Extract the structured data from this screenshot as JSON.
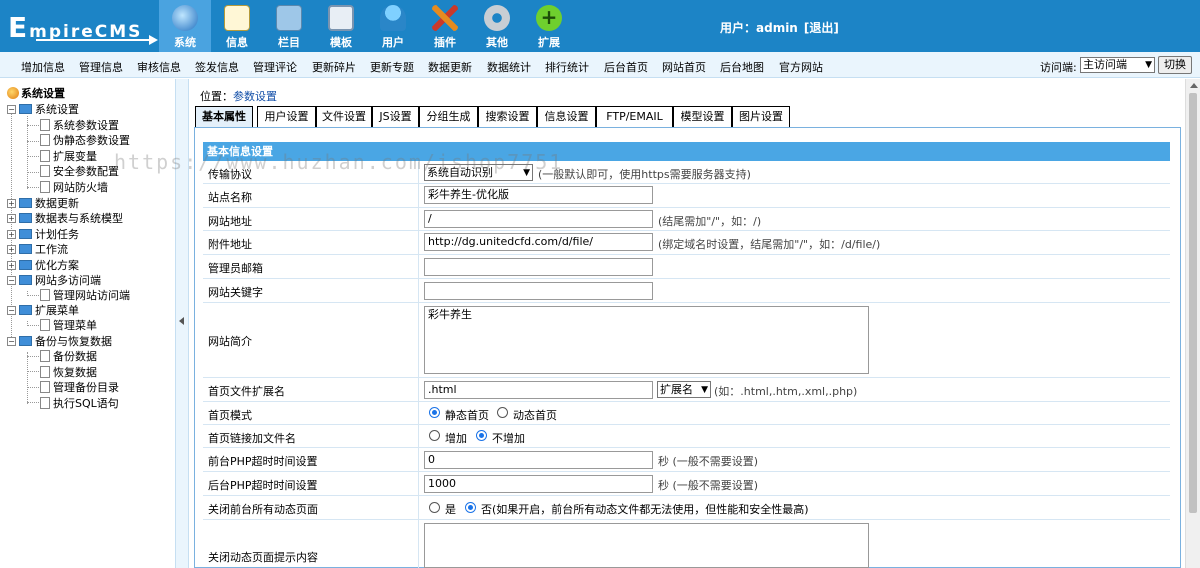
{
  "header": {
    "logo_text_big": "E",
    "logo_text_rest": "mpireCMS",
    "nav": [
      {
        "label": "系统",
        "icon": "globe-icon",
        "active": true
      },
      {
        "label": "信息",
        "icon": "notepad-icon",
        "active": false
      },
      {
        "label": "栏目",
        "icon": "folder-icon",
        "active": false
      },
      {
        "label": "模板",
        "icon": "window-icon",
        "active": false
      },
      {
        "label": "用户",
        "icon": "user-icon",
        "active": false
      },
      {
        "label": "插件",
        "icon": "tools-icon",
        "active": false
      },
      {
        "label": "其他",
        "icon": "gear-icon",
        "active": false
      },
      {
        "label": "扩展",
        "icon": "plus-icon",
        "active": false
      }
    ],
    "user_label": "用户：admin",
    "logout_label": "[退出]"
  },
  "toolbar": {
    "items": [
      "增加信息",
      "管理信息",
      "审核信息",
      "签发信息",
      "管理评论",
      "更新碎片",
      "更新专题",
      "数据更新",
      "数据统计",
      "排行统计",
      "后台首页",
      "网站首页",
      "后台地图",
      "官方网站"
    ],
    "visit_label": "访问端:",
    "visit_value": "主访问端",
    "switch_label": "切换"
  },
  "sidebar": {
    "root": "系统设置",
    "nodes": [
      {
        "label": "系统设置",
        "type": "folder",
        "level": 1
      },
      {
        "label": "系统参数设置",
        "type": "doc",
        "level": 2
      },
      {
        "label": "伪静态参数设置",
        "type": "doc",
        "level": 2
      },
      {
        "label": "扩展变量",
        "type": "doc",
        "level": 2
      },
      {
        "label": "安全参数配置",
        "type": "doc",
        "level": 2
      },
      {
        "label": "网站防火墙",
        "type": "doc",
        "level": 2
      },
      {
        "label": "数据更新",
        "type": "folder",
        "level": 1
      },
      {
        "label": "数据表与系统模型",
        "type": "folder",
        "level": 1
      },
      {
        "label": "计划任务",
        "type": "folder",
        "level": 1
      },
      {
        "label": "工作流",
        "type": "folder",
        "level": 1
      },
      {
        "label": "优化方案",
        "type": "folder",
        "level": 1
      },
      {
        "label": "网站多访问端",
        "type": "folder",
        "level": 1
      },
      {
        "label": "管理网站访问端",
        "type": "doc",
        "level": 2
      },
      {
        "label": "扩展菜单",
        "type": "folder",
        "level": 1
      },
      {
        "label": "管理菜单",
        "type": "doc",
        "level": 2
      },
      {
        "label": "备份与恢复数据",
        "type": "folder",
        "level": 1
      },
      {
        "label": "备份数据",
        "type": "doc",
        "level": 2
      },
      {
        "label": "恢复数据",
        "type": "doc",
        "level": 2
      },
      {
        "label": "管理备份目录",
        "type": "doc",
        "level": 2
      },
      {
        "label": "执行SQL语句",
        "type": "doc",
        "level": 2
      }
    ]
  },
  "main": {
    "crumb_prefix": "位置：",
    "crumb_link": "参数设置",
    "tabs": [
      "基本属性",
      "用户设置",
      "文件设置",
      "JS设置",
      "分组生成",
      "搜索设置",
      "信息设置",
      "FTP/EMAIL",
      "模型设置",
      "图片设置"
    ],
    "section_title": "基本信息设置",
    "form": {
      "protocol_label": "传输协议",
      "protocol_value": "系统自动识别",
      "protocol_note": "(一般默认即可，使用https需要服务器支持)",
      "sitename_label": "站点名称",
      "sitename_value": "彩牛养生-优化版",
      "siteurl_label": "网站地址",
      "siteurl_value": "/",
      "siteurl_note": "(结尾需加\"/\"，如：/)",
      "fileurl_label": "附件地址",
      "fileurl_value": "http://dg.unitedcfd.com/d/file/",
      "fileurl_note": "(绑定域名时设置，结尾需加\"/\"，如：/d/file/)",
      "email_label": "管理员邮箱",
      "email_value": "",
      "keywords_label": "网站关键字",
      "keywords_value": "",
      "intro_label": "网站简介",
      "intro_value": "彩牛养生",
      "indexext_label": "首页文件扩展名",
      "indexext_value": ".html",
      "indexext_select": "扩展名",
      "indexext_note": "(如：.html,.htm,.xml,.php)",
      "indexmode_label": "首页模式",
      "indexmode_opt1": "静态首页",
      "indexmode_opt2": "动态首页",
      "indexlink_label": "首页链接加文件名",
      "indexlink_opt1": "增加",
      "indexlink_opt2": "不增加",
      "fronttimeout_label": "前台PHP超时时间设置",
      "fronttimeout_value": "0",
      "fronttimeout_note": "秒 (一般不需要设置)",
      "backtimeout_label": "后台PHP超时时间设置",
      "backtimeout_value": "1000",
      "backtimeout_note": "秒 (一般不需要设置)",
      "closedyn_label": "关闭前台所有动态页面",
      "closedyn_opt1": "是",
      "closedyn_opt2": "否(如果开启，前台所有动态文件都无法使用，但性能和安全性最高)",
      "closemsg_label": "关闭动态页面提示内容",
      "closemsg_value": ""
    }
  },
  "watermark": "https://www.huzhan.com/ishop7751",
  "colors": {
    "header": "#1c84c6",
    "active_nav": "#4aa3e0",
    "section_bar": "#4aa6e4"
  }
}
